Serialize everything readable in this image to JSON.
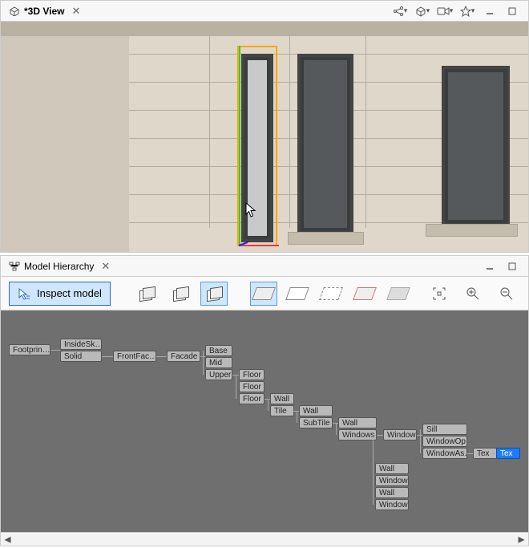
{
  "view3d": {
    "title": "*3D View",
    "tools": [
      "share",
      "cube",
      "camera",
      "star",
      "minimize",
      "restore"
    ]
  },
  "hierarchy": {
    "title": "Model Hierarchy",
    "inspect_label": "Inspect model",
    "nodes": {
      "footprint": "Footprin…",
      "insidesk": "InsideSk…",
      "solid": "Solid",
      "frontfac": "FrontFac…",
      "facade": "Facade",
      "base": "Base",
      "mid": "Mid",
      "upper": "Upper",
      "floor": "Floor",
      "wall": "Wall",
      "tile": "Tile",
      "subtile": "SubTile",
      "windows": "Windows",
      "window": "Window",
      "sill": "Sill",
      "windowop": "WindowOp…",
      "windowas": "WindowAs…",
      "tex": "Tex"
    }
  }
}
